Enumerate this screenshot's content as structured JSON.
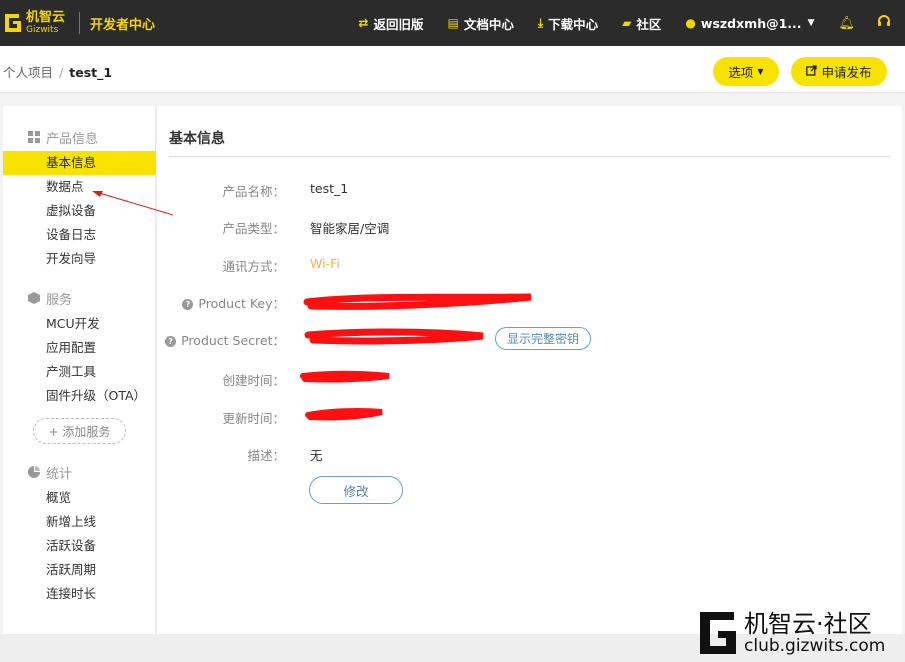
{
  "brand": {
    "name_cn": "机智云",
    "name_en": "Gizwits",
    "section": "开发者中心"
  },
  "nav": {
    "items": [
      {
        "label": "返回旧版",
        "icon": "swap-icon"
      },
      {
        "label": "文档中心",
        "icon": "document-icon"
      },
      {
        "label": "下载中心",
        "icon": "download-icon"
      },
      {
        "label": "社区",
        "icon": "chat-icon"
      }
    ],
    "user": "wszdxmh@1...",
    "user_icon": "user-icon",
    "bell_icon": "bell-icon",
    "support_icon": "headset-icon"
  },
  "breadcrumb": {
    "parent": "个人项目",
    "separator": "/",
    "current": "test_1"
  },
  "actions": {
    "options_label": "选项",
    "publish_label": "申请发布"
  },
  "sidebar": {
    "groups": [
      {
        "title": "产品信息",
        "icon": "grid-icon",
        "items": [
          "基本信息",
          "数据点",
          "虚拟设备",
          "设备日志",
          "开发向导"
        ]
      },
      {
        "title": "服务",
        "icon": "box-icon",
        "items": [
          "MCU开发",
          "应用配置",
          "产测工具",
          "固件升级（OTA）"
        ]
      },
      {
        "title": "统计",
        "icon": "pie-chart-icon",
        "items": [
          "概览",
          "新增上线",
          "活跃设备",
          "活跃周期",
          "连接时长"
        ]
      }
    ],
    "active_item": "基本信息",
    "add_service_label": "+ 添加服务"
  },
  "main": {
    "title": "基本信息",
    "fields": [
      {
        "label": "产品名称：",
        "value": "test_1"
      },
      {
        "label": "产品类型：",
        "value": "智能家居/空调"
      },
      {
        "label": "通讯方式：",
        "value": "Wi-Fi"
      },
      {
        "label": "Product Key：",
        "value": ""
      },
      {
        "label": "Product Secret：",
        "value": ""
      },
      {
        "label": "创建时间：",
        "value": ""
      },
      {
        "label": "更新时间：",
        "value": ""
      },
      {
        "label": "描述：",
        "value": "无"
      }
    ],
    "show_secret_label": "显示完整密钥",
    "edit_label": "修改",
    "redaction_color": "#ff0000"
  },
  "watermark": {
    "text": "机智云·社区",
    "url": "club.gizwits.com"
  },
  "colors": {
    "accent": "#f8e300",
    "topbar": "#2b2b2b",
    "wifi": "#f0b356"
  }
}
